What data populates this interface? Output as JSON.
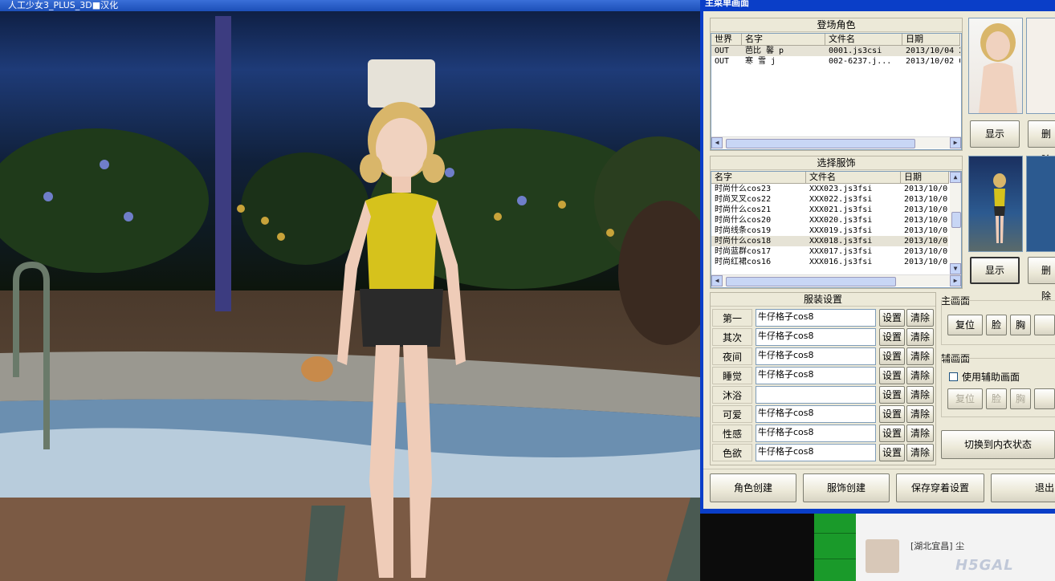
{
  "game": {
    "title": "人工少女3_PLUS_3D■汉化"
  },
  "dialog": {
    "title": "主菜单画面",
    "characters": {
      "title": "登场角色",
      "columns": [
        "世界",
        "名字",
        "文件名",
        "日期"
      ],
      "rows": [
        [
          "OUT",
          "芭比 馨 p",
          "0001.js3csi",
          "2013/10/04 2"
        ],
        [
          "OUT",
          "寒 雪 j",
          "002-6237.j...",
          "2013/10/02 0"
        ]
      ]
    },
    "outfits": {
      "title": "选择服饰",
      "columns": [
        "名字",
        "文件名",
        "日期"
      ],
      "rows": [
        [
          "时尚什么cos23",
          "XXX023.js3fsi",
          "2013/10/0"
        ],
        [
          "时尚叉叉cos22",
          "XXX022.js3fsi",
          "2013/10/0"
        ],
        [
          "时尚什么cos21",
          "XXX021.js3fsi",
          "2013/10/0"
        ],
        [
          "时尚什么cos20",
          "XXX020.js3fsi",
          "2013/10/0"
        ],
        [
          "时尚线条cos19",
          "XXX019.js3fsi",
          "2013/10/0"
        ],
        [
          "时尚什么cos18",
          "XXX018.js3fsi",
          "2013/10/0"
        ],
        [
          "时尚蓝群cos17",
          "XXX017.js3fsi",
          "2013/10/0"
        ],
        [
          "时尚红裙cos16",
          "XXX016.js3fsi",
          "2013/10/0"
        ]
      ],
      "selected_index": 5
    },
    "clothing_settings": {
      "title": "服装设置",
      "set_label": "设置",
      "clear_label": "清除",
      "rows": [
        {
          "label": "第一",
          "value": "牛仔格子cos8"
        },
        {
          "label": "其次",
          "value": "牛仔格子cos8"
        },
        {
          "label": "夜间",
          "value": "牛仔格子cos8"
        },
        {
          "label": "睡觉",
          "value": "牛仔格子cos8"
        },
        {
          "label": "沐浴",
          "value": ""
        },
        {
          "label": "可爱",
          "value": "牛仔格子cos8"
        },
        {
          "label": "性感",
          "value": "牛仔格子cos8"
        },
        {
          "label": "色欲",
          "value": "牛仔格子cos8"
        }
      ]
    },
    "preview": {
      "show_label": "显示",
      "delete_label": "删除"
    },
    "main_screen": {
      "title": "主画面",
      "buttons": [
        "复位",
        "脸",
        "胸"
      ]
    },
    "aux_screen": {
      "title": "辅画面",
      "checkbox_label": "使用辅助画面",
      "buttons": [
        "复位",
        "脸",
        "胸"
      ]
    },
    "underwear_toggle": "切换到内衣状态",
    "bottom_buttons": [
      "角色创建",
      "服饰创建",
      "保存穿着设置",
      "退出"
    ]
  },
  "backdrop": {
    "comment_text": "[湖北宜昌] 尘",
    "watermark": "H5GAL"
  },
  "colors": {
    "dialog_title": "#0a3ec8",
    "dialog_bg": "#ece9d8",
    "green_panel": "#1a9a2a"
  }
}
